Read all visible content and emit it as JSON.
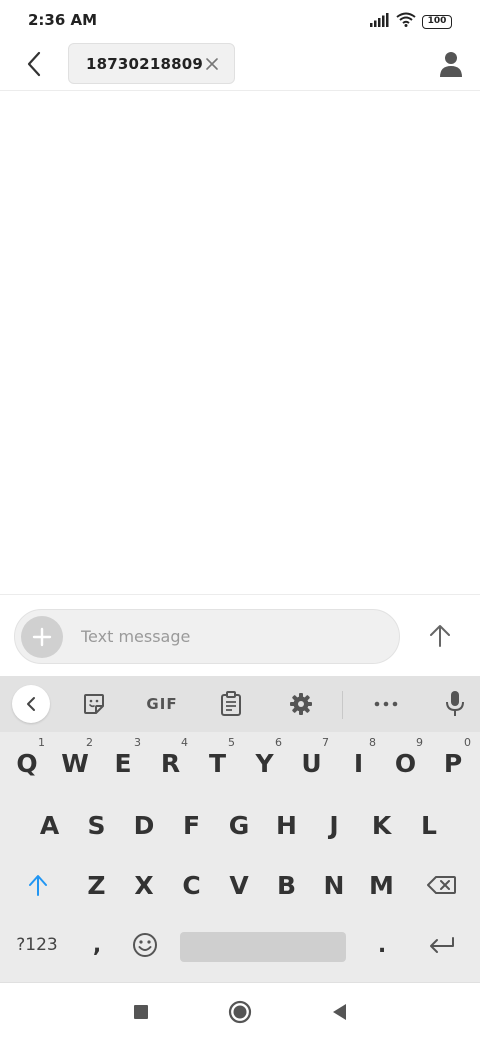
{
  "status_bar": {
    "time": "2:36 AM",
    "battery": "100",
    "icons": [
      "signal-icon",
      "wifi-icon",
      "battery-icon"
    ]
  },
  "header": {
    "recipient": "18730218809",
    "icons": [
      "back-arrow-icon",
      "close-icon",
      "contact-icon"
    ]
  },
  "compose": {
    "placeholder": "Text message",
    "value": "",
    "icons": [
      "plus-icon",
      "send-arrow-icon"
    ]
  },
  "keyboard": {
    "toolbar": {
      "gif_label": "GIF",
      "icons": [
        "chevron-left-icon",
        "sticker-icon",
        "gif-icon",
        "clipboard-icon",
        "gear-icon",
        "more-icon",
        "microphone-icon"
      ]
    },
    "row1": [
      {
        "key": "Q",
        "hint": "1"
      },
      {
        "key": "W",
        "hint": "2"
      },
      {
        "key": "E",
        "hint": "3"
      },
      {
        "key": "R",
        "hint": "4"
      },
      {
        "key": "T",
        "hint": "5"
      },
      {
        "key": "Y",
        "hint": "6"
      },
      {
        "key": "U",
        "hint": "7"
      },
      {
        "key": "I",
        "hint": "8"
      },
      {
        "key": "O",
        "hint": "9"
      },
      {
        "key": "P",
        "hint": "0"
      }
    ],
    "row2": [
      "A",
      "S",
      "D",
      "F",
      "G",
      "H",
      "J",
      "K",
      "L"
    ],
    "row3": [
      "Z",
      "X",
      "C",
      "V",
      "B",
      "N",
      "M"
    ],
    "row4": {
      "symbols": "?123",
      "comma": ",",
      "period": "."
    },
    "icons": [
      "shift-icon",
      "backspace-icon",
      "emoji-icon",
      "enter-icon"
    ]
  },
  "nav_bar": {
    "icons": [
      "recents-square-icon",
      "home-circle-icon",
      "back-triangle-icon"
    ]
  },
  "colors": {
    "accent": "#2196F3",
    "keyboard_bg": "#ebebeb",
    "toolbar_bg": "#e2e2e2"
  }
}
